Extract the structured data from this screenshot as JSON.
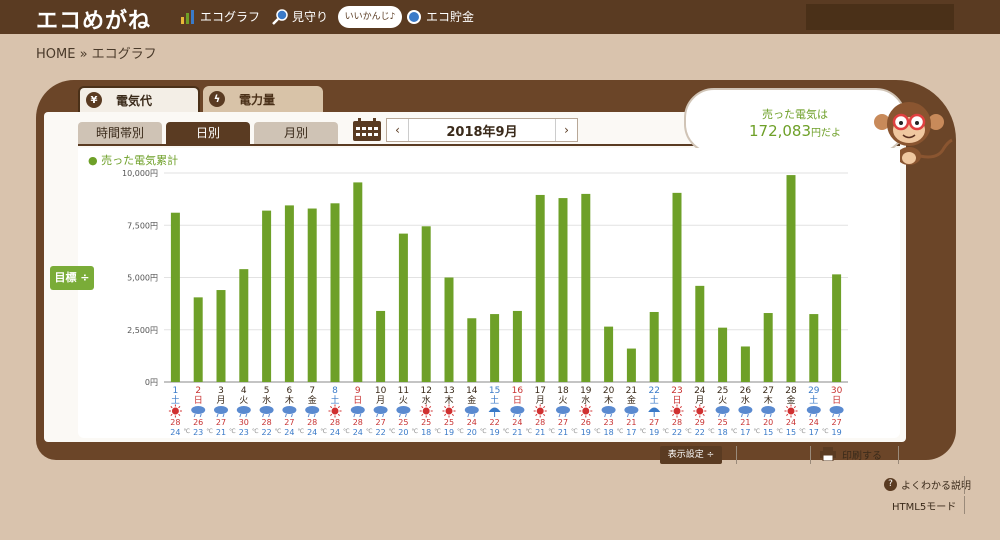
{
  "header": {
    "logo": "エコめがね",
    "nav": [
      {
        "label": "エコグラフ",
        "icon": "bar-chart-icon"
      },
      {
        "label": "見守り",
        "icon": "magnifier-icon"
      },
      {
        "label": "エコ貯金",
        "icon": "piggy-bank-icon"
      }
    ],
    "bubble": "いいかんじ♪"
  },
  "breadcrumb": "HOME » エコグラフ",
  "main_tabs": [
    {
      "label": "電気代",
      "icon_char": "¥"
    },
    {
      "label": "電力量",
      "icon_char": "ϟ"
    }
  ],
  "sub_tabs": [
    "時間帯別",
    "日別",
    "月別"
  ],
  "date": {
    "label": "2018年9月",
    "prev": "‹",
    "next": "›"
  },
  "sold": {
    "line1": "売った電気は",
    "amount": "172,083",
    "suffix": "円だよ"
  },
  "legend": "● 売った電気累計",
  "goal_button": "目標 ÷",
  "display_settings": "表示設定 ÷",
  "print": "印刷する",
  "help": "よくわかる説明",
  "html5": "HTML5モード",
  "colors": {
    "bar": "#6ea028",
    "saturday": "#3a7ac8",
    "sunday": "#c83232",
    "weekday": "#3a2a1a"
  },
  "chart_data": {
    "type": "bar",
    "ylim": [
      0,
      10000
    ],
    "yticks": [
      "0円",
      "2,500円",
      "5,000円",
      "7,500円",
      "10,000円"
    ],
    "ytick_values": [
      0,
      2500,
      5000,
      7500,
      10000
    ],
    "days": [
      "1",
      "2",
      "3",
      "4",
      "5",
      "6",
      "7",
      "8",
      "9",
      "10",
      "11",
      "12",
      "13",
      "14",
      "15",
      "16",
      "17",
      "18",
      "19",
      "20",
      "21",
      "22",
      "23",
      "24",
      "25",
      "26",
      "27",
      "28",
      "29",
      "30"
    ],
    "weekdays": [
      "土",
      "日",
      "月",
      "火",
      "水",
      "木",
      "金",
      "土",
      "日",
      "月",
      "火",
      "水",
      "木",
      "金",
      "土",
      "日",
      "月",
      "火",
      "水",
      "木",
      "金",
      "土",
      "日",
      "月",
      "火",
      "水",
      "木",
      "金",
      "土",
      "日"
    ],
    "values": [
      8100,
      4050,
      4400,
      5400,
      8200,
      8450,
      8300,
      8550,
      9550,
      3400,
      7100,
      7450,
      5000,
      3050,
      3250,
      3400,
      8950,
      8800,
      9000,
      2650,
      1600,
      3350,
      9050,
      4600,
      2600,
      1700,
      3300,
      9900,
      3250,
      5150
    ],
    "weather": [
      "sunny",
      "cloudy-rain",
      "cloudy-rain",
      "cloudy-rain",
      "cloudy-rain",
      "cloudy-rain",
      "cloudy-rain",
      "sunny",
      "cloudy-rain",
      "cloudy-rain",
      "cloudy-rain",
      "sunny",
      "sunny",
      "cloudy-rain",
      "umbrella",
      "cloudy-rain",
      "sunny",
      "cloudy-rain",
      "sunny",
      "cloudy-rain",
      "cloudy-rain",
      "umbrella",
      "sunny",
      "sunny",
      "cloudy-rain",
      "cloudy-rain",
      "cloudy-rain",
      "sunny",
      "cloudy-rain",
      "cloudy-rain"
    ],
    "temp_high": [
      "28",
      "26",
      "27",
      "30",
      "28",
      "27",
      "28",
      "28",
      "28",
      "27",
      "25",
      "25",
      "25",
      "24",
      "22",
      "24",
      "28",
      "27",
      "26",
      "23",
      "21",
      "27",
      "28",
      "29",
      "25",
      "21",
      "20",
      "24",
      "24",
      "27"
    ],
    "temp_low": [
      "24",
      "23",
      "21",
      "23",
      "22",
      "24",
      "24",
      "24",
      "24",
      "22",
      "20",
      "18",
      "19",
      "20",
      "19",
      "21",
      "21",
      "21",
      "19",
      "18",
      "17",
      "19",
      "22",
      "22",
      "18",
      "17",
      "15",
      "15",
      "17",
      "19"
    ]
  }
}
